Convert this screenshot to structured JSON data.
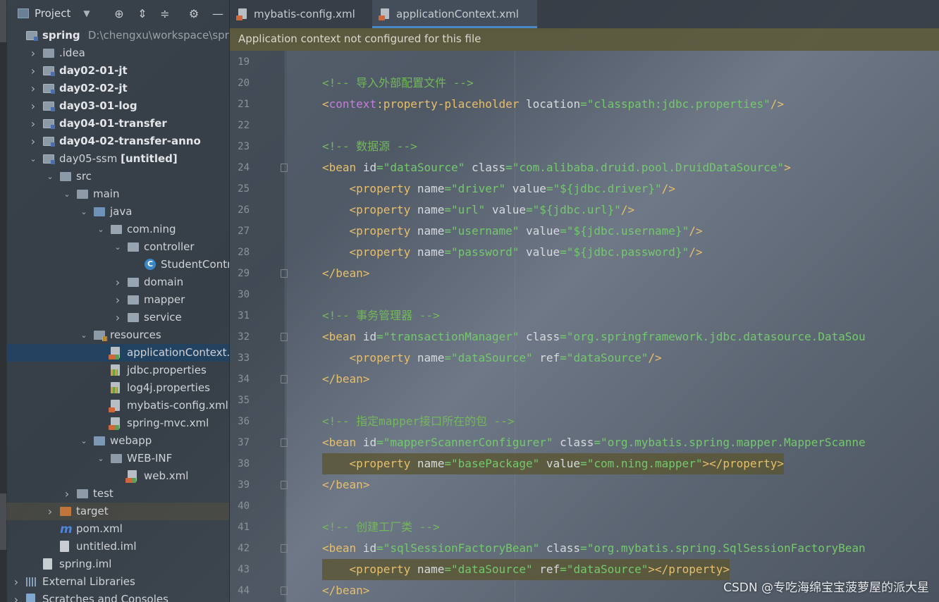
{
  "project_panel": {
    "title": "Project",
    "icons": [
      "locate-icon",
      "expand-all-icon",
      "collapse-all-icon",
      "gear-icon",
      "hide-icon"
    ],
    "tree": [
      {
        "label": "spring",
        "path": "D:\\chengxu\\workspace\\spring",
        "depth": 0,
        "arrow": "",
        "icon": "module",
        "bold": true
      },
      {
        "label": ".idea",
        "depth": 1,
        "arrow": "›",
        "icon": "folder"
      },
      {
        "label": "day02-01-jt",
        "depth": 1,
        "arrow": "›",
        "icon": "module",
        "bold": true
      },
      {
        "label": "day02-02-jt",
        "depth": 1,
        "arrow": "›",
        "icon": "module",
        "bold": true
      },
      {
        "label": "day03-01-log",
        "depth": 1,
        "arrow": "›",
        "icon": "module",
        "bold": true
      },
      {
        "label": "day04-01-transfer",
        "depth": 1,
        "arrow": "›",
        "icon": "module",
        "bold": true
      },
      {
        "label": "day04-02-transfer-anno",
        "depth": 1,
        "arrow": "›",
        "icon": "module",
        "bold": true
      },
      {
        "label": "day05-ssm",
        "suffix": "[untitled]",
        "depth": 1,
        "arrow": "⌄",
        "icon": "module"
      },
      {
        "label": "src",
        "depth": 2,
        "arrow": "⌄",
        "icon": "folder"
      },
      {
        "label": "main",
        "depth": 3,
        "arrow": "⌄",
        "icon": "folder"
      },
      {
        "label": "java",
        "depth": 4,
        "arrow": "⌄",
        "icon": "folder-blue"
      },
      {
        "label": "com.ning",
        "depth": 5,
        "arrow": "⌄",
        "icon": "package"
      },
      {
        "label": "controller",
        "depth": 6,
        "arrow": "⌄",
        "icon": "package"
      },
      {
        "label": "StudentController",
        "depth": 7,
        "arrow": "",
        "icon": "class"
      },
      {
        "label": "domain",
        "depth": 6,
        "arrow": "›",
        "icon": "package"
      },
      {
        "label": "mapper",
        "depth": 6,
        "arrow": "›",
        "icon": "package"
      },
      {
        "label": "service",
        "depth": 6,
        "arrow": "›",
        "icon": "package"
      },
      {
        "label": "resources",
        "depth": 4,
        "arrow": "⌄",
        "icon": "resources"
      },
      {
        "label": "applicationContext.xml",
        "depth": 5,
        "arrow": "",
        "icon": "xmlg",
        "selected": true
      },
      {
        "label": "jdbc.properties",
        "depth": 5,
        "arrow": "",
        "icon": "prop"
      },
      {
        "label": "log4j.properties",
        "depth": 5,
        "arrow": "",
        "icon": "prop"
      },
      {
        "label": "mybatis-config.xml",
        "depth": 5,
        "arrow": "",
        "icon": "xml"
      },
      {
        "label": "spring-mvc.xml",
        "depth": 5,
        "arrow": "",
        "icon": "xmlg"
      },
      {
        "label": "webapp",
        "depth": 4,
        "arrow": "⌄",
        "icon": "folder-web"
      },
      {
        "label": "WEB-INF",
        "depth": 5,
        "arrow": "⌄",
        "icon": "folder"
      },
      {
        "label": "web.xml",
        "depth": 6,
        "arrow": "",
        "icon": "xmlg"
      },
      {
        "label": "test",
        "depth": 3,
        "arrow": "›",
        "icon": "folder"
      },
      {
        "label": "target",
        "depth": 2,
        "arrow": "›",
        "icon": "folder-orange",
        "hover": true
      },
      {
        "label": "pom.xml",
        "depth": 2,
        "arrow": "",
        "icon": "pom"
      },
      {
        "label": "untitled.iml",
        "depth": 2,
        "arrow": "",
        "icon": "iml"
      },
      {
        "label": "spring.iml",
        "depth": 1,
        "arrow": "",
        "icon": "iml"
      },
      {
        "label": "External Libraries",
        "depth": 0,
        "arrow": "›",
        "icon": "libs"
      },
      {
        "label": "Scratches and Consoles",
        "depth": 0,
        "arrow": "›",
        "icon": "scratch"
      }
    ]
  },
  "editor": {
    "tabs": [
      {
        "label": "mybatis-config.xml",
        "active": false
      },
      {
        "label": "applicationContext.xml",
        "active": true
      }
    ],
    "banner": "Application context not configured for this file",
    "lines": [
      {
        "n": "19",
        "fold": false,
        "hl": false,
        "parts": []
      },
      {
        "n": "20",
        "fold": false,
        "hl": false,
        "parts": [
          {
            "t": "com",
            "s": "<!-- 导入外部配置文件 -->"
          }
        ]
      },
      {
        "n": "21",
        "fold": false,
        "hl": false,
        "parts": [
          {
            "t": "tag",
            "s": "<"
          },
          {
            "t": "ns",
            "s": "context"
          },
          {
            "t": "tag",
            "s": ":property-placeholder"
          },
          {
            "t": "attr",
            "s": " location"
          },
          {
            "t": "val",
            "s": "=\"classpath:jdbc.properties\""
          },
          {
            "t": "tag",
            "s": "/>"
          }
        ]
      },
      {
        "n": "22",
        "fold": false,
        "hl": false,
        "parts": []
      },
      {
        "n": "23",
        "fold": false,
        "hl": false,
        "parts": [
          {
            "t": "com",
            "s": "<!-- 数据源 -->"
          }
        ]
      },
      {
        "n": "24",
        "fold": true,
        "hl": false,
        "parts": [
          {
            "t": "tag",
            "s": "<bean"
          },
          {
            "t": "attr",
            "s": " id"
          },
          {
            "t": "val",
            "s": "=\"dataSource\""
          },
          {
            "t": "attr",
            "s": " class"
          },
          {
            "t": "val",
            "s": "=\"com.alibaba.druid.pool.DruidDataSource\""
          },
          {
            "t": "tag",
            "s": ">"
          }
        ]
      },
      {
        "n": "25",
        "fold": false,
        "hl": false,
        "parts": [
          {
            "t": "plain",
            "s": "    "
          },
          {
            "t": "tag",
            "s": "<property"
          },
          {
            "t": "attr",
            "s": " name"
          },
          {
            "t": "val",
            "s": "=\"driver\""
          },
          {
            "t": "attr",
            "s": " value"
          },
          {
            "t": "val",
            "s": "=\"${jdbc.driver}\""
          },
          {
            "t": "tag",
            "s": "/>"
          }
        ]
      },
      {
        "n": "26",
        "fold": false,
        "hl": false,
        "parts": [
          {
            "t": "plain",
            "s": "    "
          },
          {
            "t": "tag",
            "s": "<property"
          },
          {
            "t": "attr",
            "s": " name"
          },
          {
            "t": "val",
            "s": "=\"url\""
          },
          {
            "t": "attr",
            "s": " value"
          },
          {
            "t": "val",
            "s": "=\"${jdbc.url}\""
          },
          {
            "t": "tag",
            "s": "/>"
          }
        ]
      },
      {
        "n": "27",
        "fold": false,
        "hl": false,
        "parts": [
          {
            "t": "plain",
            "s": "    "
          },
          {
            "t": "tag",
            "s": "<property"
          },
          {
            "t": "attr",
            "s": " name"
          },
          {
            "t": "val",
            "s": "=\"username\""
          },
          {
            "t": "attr",
            "s": " value"
          },
          {
            "t": "val",
            "s": "=\"${jdbc.username}\""
          },
          {
            "t": "tag",
            "s": "/>"
          }
        ]
      },
      {
        "n": "28",
        "fold": false,
        "hl": false,
        "parts": [
          {
            "t": "plain",
            "s": "    "
          },
          {
            "t": "tag",
            "s": "<property"
          },
          {
            "t": "attr",
            "s": " name"
          },
          {
            "t": "val",
            "s": "=\"password\""
          },
          {
            "t": "attr",
            "s": " value"
          },
          {
            "t": "val",
            "s": "=\"${jdbc.password}\""
          },
          {
            "t": "tag",
            "s": "/>"
          }
        ]
      },
      {
        "n": "29",
        "fold": true,
        "hl": false,
        "parts": [
          {
            "t": "tag",
            "s": "</bean>"
          }
        ]
      },
      {
        "n": "30",
        "fold": false,
        "hl": false,
        "parts": []
      },
      {
        "n": "31",
        "fold": false,
        "hl": false,
        "parts": [
          {
            "t": "com",
            "s": "<!-- 事务管理器 -->"
          }
        ]
      },
      {
        "n": "32",
        "fold": true,
        "hl": false,
        "parts": [
          {
            "t": "tag",
            "s": "<bean"
          },
          {
            "t": "attr",
            "s": " id"
          },
          {
            "t": "val",
            "s": "=\"transactionManager\""
          },
          {
            "t": "attr",
            "s": " class"
          },
          {
            "t": "val",
            "s": "=\"org.springframework.jdbc.datasource.DataSou"
          }
        ]
      },
      {
        "n": "33",
        "fold": false,
        "hl": false,
        "parts": [
          {
            "t": "plain",
            "s": "    "
          },
          {
            "t": "tag",
            "s": "<property"
          },
          {
            "t": "attr",
            "s": " name"
          },
          {
            "t": "val",
            "s": "=\"dataSource\""
          },
          {
            "t": "attr",
            "s": " ref"
          },
          {
            "t": "val",
            "s": "=\"dataSource\""
          },
          {
            "t": "tag",
            "s": "/>"
          }
        ]
      },
      {
        "n": "34",
        "fold": true,
        "hl": false,
        "parts": [
          {
            "t": "tag",
            "s": "</bean>"
          }
        ]
      },
      {
        "n": "35",
        "fold": false,
        "hl": false,
        "parts": []
      },
      {
        "n": "36",
        "fold": false,
        "hl": false,
        "parts": [
          {
            "t": "com",
            "s": "<!-- 指定mapper接口所在的包 -->"
          }
        ]
      },
      {
        "n": "37",
        "fold": true,
        "hl": false,
        "parts": [
          {
            "t": "tag",
            "s": "<bean"
          },
          {
            "t": "attr",
            "s": " id"
          },
          {
            "t": "val",
            "s": "=\"mapperScannerConfigurer\""
          },
          {
            "t": "attr",
            "s": " class"
          },
          {
            "t": "val",
            "s": "=\"org.mybatis.spring.mapper.MapperScanne"
          }
        ]
      },
      {
        "n": "38",
        "fold": false,
        "hl": true,
        "parts": [
          {
            "t": "plain",
            "s": "    "
          },
          {
            "t": "tag",
            "s": "<property"
          },
          {
            "t": "attr",
            "s": " name"
          },
          {
            "t": "val",
            "s": "=\"basePackage\""
          },
          {
            "t": "attr",
            "s": " value"
          },
          {
            "t": "val",
            "s": "=\"com.ning.mapper\""
          },
          {
            "t": "tag",
            "s": "></property>"
          }
        ]
      },
      {
        "n": "39",
        "fold": true,
        "hl": false,
        "parts": [
          {
            "t": "tag",
            "s": "</bean>"
          }
        ]
      },
      {
        "n": "40",
        "fold": false,
        "hl": false,
        "parts": []
      },
      {
        "n": "41",
        "fold": false,
        "hl": false,
        "parts": [
          {
            "t": "com",
            "s": "<!-- 创建工厂类 -->"
          }
        ]
      },
      {
        "n": "42",
        "fold": true,
        "hl": false,
        "parts": [
          {
            "t": "tag",
            "s": "<bean"
          },
          {
            "t": "attr",
            "s": " id"
          },
          {
            "t": "val",
            "s": "=\"sqlSessionFactoryBean\""
          },
          {
            "t": "attr",
            "s": " class"
          },
          {
            "t": "val",
            "s": "=\"org.mybatis.spring.SqlSessionFactoryBean"
          }
        ]
      },
      {
        "n": "43",
        "fold": false,
        "hl": true,
        "parts": [
          {
            "t": "plain",
            "s": "    "
          },
          {
            "t": "tag",
            "s": "<property"
          },
          {
            "t": "attr",
            "s": " name"
          },
          {
            "t": "val",
            "s": "=\"dataSource\""
          },
          {
            "t": "attr",
            "s": " ref"
          },
          {
            "t": "val",
            "s": "=\"dataSource\""
          },
          {
            "t": "tag",
            "s": "></property>"
          }
        ]
      },
      {
        "n": "44",
        "fold": true,
        "hl": false,
        "parts": [
          {
            "t": "tag",
            "s": "</bean>"
          }
        ]
      }
    ]
  },
  "watermark": "CSDN @专吃海绵宝宝菠萝屋的派大星",
  "colors": {
    "selection": "#214262",
    "banner": "#5c5a3c",
    "tab_underline": "#4a88c7",
    "comment": "#73b85a",
    "tag": "#e8bf6a",
    "value": "#73c96b"
  }
}
